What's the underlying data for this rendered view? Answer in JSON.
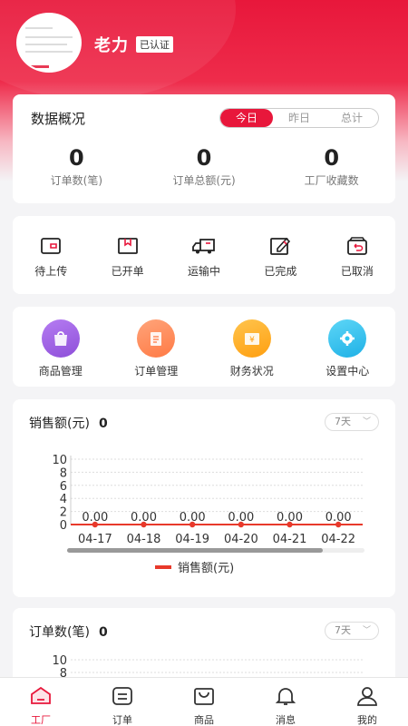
{
  "header": {
    "username": "老力",
    "verified_badge": "已认证"
  },
  "overview": {
    "title": "数据概况",
    "tabs": [
      "今日",
      "昨日",
      "总计"
    ],
    "stats": [
      {
        "value": "0",
        "label": "订单数(笔)"
      },
      {
        "value": "0",
        "label": "订单总额(元)"
      },
      {
        "value": "0",
        "label": "工厂收藏数"
      }
    ]
  },
  "order_status": [
    {
      "label": "待上传",
      "icon": "wallet-icon"
    },
    {
      "label": "已开单",
      "icon": "package-icon"
    },
    {
      "label": "运输中",
      "icon": "truck-icon"
    },
    {
      "label": "已完成",
      "icon": "edit-icon"
    },
    {
      "label": "已取消",
      "icon": "cancel-box-icon"
    }
  ],
  "tools": [
    {
      "label": "商品管理",
      "icon": "bag-icon",
      "color": "#9b5de5"
    },
    {
      "label": "订单管理",
      "icon": "clipboard-icon",
      "color": "#ff8a5c"
    },
    {
      "label": "财务状况",
      "icon": "yen-icon",
      "color": "#ffb020"
    },
    {
      "label": "设置中心",
      "icon": "gear-icon",
      "color": "#2ec4f0"
    }
  ],
  "sales_chart": {
    "title": "销售额(元)",
    "total": "0",
    "range": "7天",
    "legend": "销售额(元)",
    "chart_data": {
      "type": "line",
      "categories": [
        "04-17",
        "04-18",
        "04-19",
        "04-20",
        "04-21",
        "04-22"
      ],
      "series": [
        {
          "name": "销售额(元)",
          "values": [
            0,
            0,
            0,
            0,
            0,
            0
          ],
          "labels": [
            "0.00",
            "0.00",
            "0.00",
            "0.00",
            "0.00",
            "0.00"
          ]
        }
      ],
      "yticks": [
        "10",
        "8",
        "6",
        "4",
        "2",
        "0"
      ],
      "ylim": [
        0,
        10
      ],
      "color": "#e8392b"
    }
  },
  "orders_chart": {
    "title": "订单数(笔)",
    "total": "0",
    "range": "7天",
    "yticks": [
      "10",
      "8"
    ]
  },
  "tabbar": [
    {
      "label": "工厂",
      "icon": "factory-icon",
      "active": true
    },
    {
      "label": "订单",
      "icon": "order-icon",
      "active": false
    },
    {
      "label": "商品",
      "icon": "goods-icon",
      "active": false
    },
    {
      "label": "消息",
      "icon": "bell-icon",
      "active": false
    },
    {
      "label": "我的",
      "icon": "user-icon",
      "active": false
    }
  ],
  "colors": {
    "accent": "#e8173b"
  }
}
